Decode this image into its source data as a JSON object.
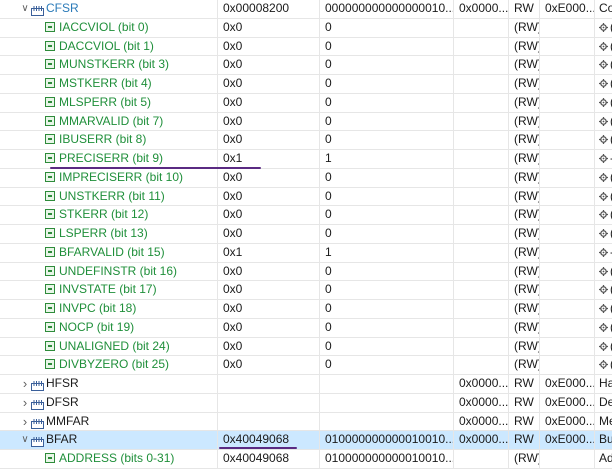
{
  "icons": {
    "expanded": "chevron-down-icon",
    "collapsed": "chevron-right-icon",
    "register": "register-icon",
    "bitfield": "bitfield-icon",
    "description": "gear-icon"
  },
  "colors": {
    "field_text": "#1f8f3a",
    "register_link": "#2a7ab8",
    "selection": "#cce8ff",
    "annotation": "#5a2a82"
  },
  "rows": [
    {
      "id": "cfsr",
      "type": "register",
      "state": "expanded",
      "name": "CFSR",
      "hex": "0x00008200",
      "bin": "000000000000000010...",
      "addr": "0x0000...",
      "access": "RW",
      "reset": "0xE000...",
      "desc": "Co"
    },
    {
      "id": "iaccviol",
      "type": "field",
      "name": "IACCVIOL (bit 0)",
      "hex": "0x0",
      "bin": "0",
      "access": "(RW)",
      "desc": "("
    },
    {
      "id": "daccviol",
      "type": "field",
      "name": "DACCVIOL (bit 1)",
      "hex": "0x0",
      "bin": "0",
      "access": "(RW)",
      "desc": "("
    },
    {
      "id": "munstkerr",
      "type": "field",
      "name": "MUNSTKERR (bit 3)",
      "hex": "0x0",
      "bin": "0",
      "access": "(RW)",
      "desc": "("
    },
    {
      "id": "mstkerr",
      "type": "field",
      "name": "MSTKERR (bit 4)",
      "hex": "0x0",
      "bin": "0",
      "access": "(RW)",
      "desc": "("
    },
    {
      "id": "mlsperr",
      "type": "field",
      "name": "MLSPERR (bit 5)",
      "hex": "0x0",
      "bin": "0",
      "access": "(RW)",
      "desc": "("
    },
    {
      "id": "mmarvalid",
      "type": "field",
      "name": "MMARVALID (bit 7)",
      "hex": "0x0",
      "bin": "0",
      "access": "(RW)",
      "desc": "("
    },
    {
      "id": "ibuserr",
      "type": "field",
      "name": "IBUSERR (bit 8)",
      "hex": "0x0",
      "bin": "0",
      "access": "(RW)",
      "desc": "("
    },
    {
      "id": "preciserr",
      "type": "field",
      "name": "PRECISERR (bit 9)",
      "hex": "0x1",
      "bin": "1",
      "access": "(RW)",
      "desc": "-"
    },
    {
      "id": "impreciserr",
      "type": "field",
      "name": "IMPRECISERR (bit 10)",
      "hex": "0x0",
      "bin": "0",
      "access": "(RW)",
      "desc": "("
    },
    {
      "id": "unstkerr",
      "type": "field",
      "name": "UNSTKERR (bit 11)",
      "hex": "0x0",
      "bin": "0",
      "access": "(RW)",
      "desc": "("
    },
    {
      "id": "stkerr",
      "type": "field",
      "name": "STKERR (bit 12)",
      "hex": "0x0",
      "bin": "0",
      "access": "(RW)",
      "desc": "("
    },
    {
      "id": "lsperr",
      "type": "field",
      "name": "LSPERR (bit 13)",
      "hex": "0x0",
      "bin": "0",
      "access": "(RW)",
      "desc": "("
    },
    {
      "id": "bfarvalid",
      "type": "field",
      "name": "BFARVALID (bit 15)",
      "hex": "0x1",
      "bin": "1",
      "access": "(RW)",
      "desc": "-"
    },
    {
      "id": "undefinstr",
      "type": "field",
      "name": "UNDEFINSTR (bit 16)",
      "hex": "0x0",
      "bin": "0",
      "access": "(RW)",
      "desc": "("
    },
    {
      "id": "invstate",
      "type": "field",
      "name": "INVSTATE (bit 17)",
      "hex": "0x0",
      "bin": "0",
      "access": "(RW)",
      "desc": "("
    },
    {
      "id": "invpc",
      "type": "field",
      "name": "INVPC (bit 18)",
      "hex": "0x0",
      "bin": "0",
      "access": "(RW)",
      "desc": "("
    },
    {
      "id": "nocp",
      "type": "field",
      "name": "NOCP (bit 19)",
      "hex": "0x0",
      "bin": "0",
      "access": "(RW)",
      "desc": "("
    },
    {
      "id": "unaligned",
      "type": "field",
      "name": "UNALIGNED (bit 24)",
      "hex": "0x0",
      "bin": "0",
      "access": "(RW)",
      "desc": "("
    },
    {
      "id": "divbyzero",
      "type": "field",
      "name": "DIVBYZERO (bit 25)",
      "hex": "0x0",
      "bin": "0",
      "access": "(RW)",
      "desc": "("
    },
    {
      "id": "hfsr",
      "type": "register",
      "state": "collapsed",
      "name": "HFSR",
      "hex": "",
      "bin": "",
      "addr": "0x0000...",
      "access": "RW",
      "reset": "0xE000...",
      "desc": "Ha"
    },
    {
      "id": "dfsr",
      "type": "register",
      "state": "collapsed",
      "name": "DFSR",
      "hex": "",
      "bin": "",
      "addr": "0x0000...",
      "access": "RW",
      "reset": "0xE000...",
      "desc": "De"
    },
    {
      "id": "mmfar",
      "type": "register",
      "state": "collapsed",
      "name": "MMFAR",
      "hex": "",
      "bin": "",
      "addr": "0x0000...",
      "access": "RW",
      "reset": "0xE000...",
      "desc": "Me"
    },
    {
      "id": "bfar",
      "type": "register",
      "state": "expanded",
      "selected": true,
      "name": "BFAR",
      "hex": "0x40049068",
      "bin": "010000000000010010...",
      "addr": "0x0000...",
      "access": "RW",
      "reset": "0xE000...",
      "desc": "Bu"
    },
    {
      "id": "address",
      "type": "field",
      "name": "ADDRESS (bits 0-31)",
      "hex": "0x40049068",
      "bin": "010000000000010010...",
      "access": "(RW)",
      "desc": "Ad"
    }
  ]
}
